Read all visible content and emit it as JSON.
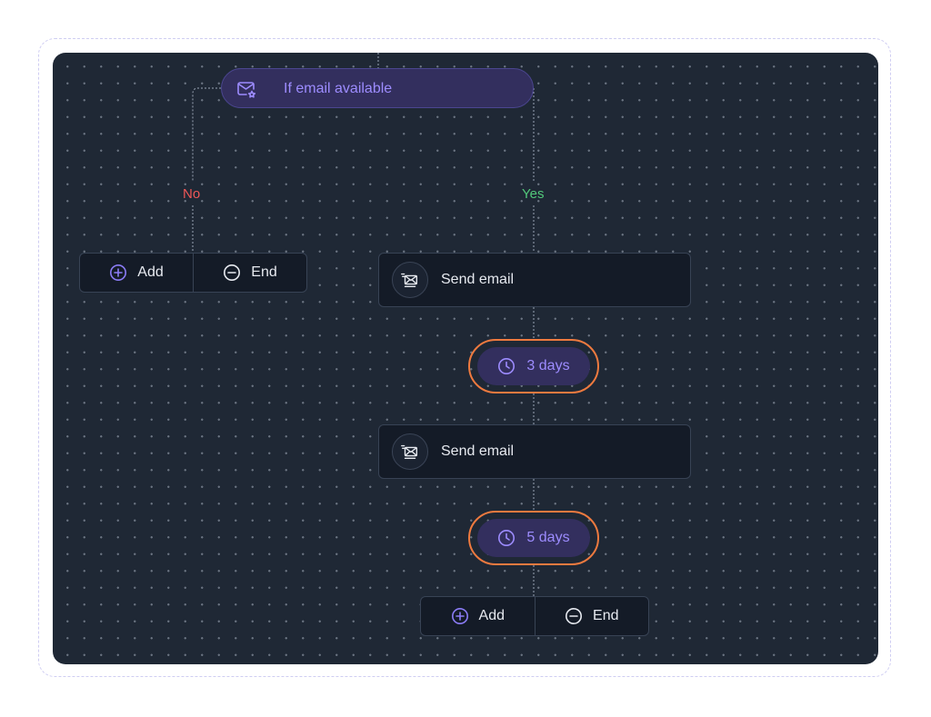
{
  "condition": {
    "label": "If email available",
    "icon": "mail-star-icon"
  },
  "branches": {
    "no_label": "No",
    "yes_label": "Yes"
  },
  "no_branch_actions": {
    "add_label": "Add",
    "end_label": "End"
  },
  "steps": [
    {
      "label": "Send email",
      "icon": "send-email-icon"
    },
    {
      "label": "Send email",
      "icon": "send-email-icon"
    }
  ],
  "delays": [
    {
      "label": "3 days",
      "icon": "clock-icon"
    },
    {
      "label": "5 days",
      "icon": "clock-icon"
    }
  ],
  "yes_branch_actions": {
    "add_label": "Add",
    "end_label": "End"
  },
  "colors": {
    "canvas_bg": "#1f2835",
    "accent_purple": "#9d8cff",
    "pill_bg": "#332f5e",
    "no_red": "#ef5757",
    "yes_green": "#52c77a",
    "delay_ring_orange": "#ee7a3f"
  }
}
